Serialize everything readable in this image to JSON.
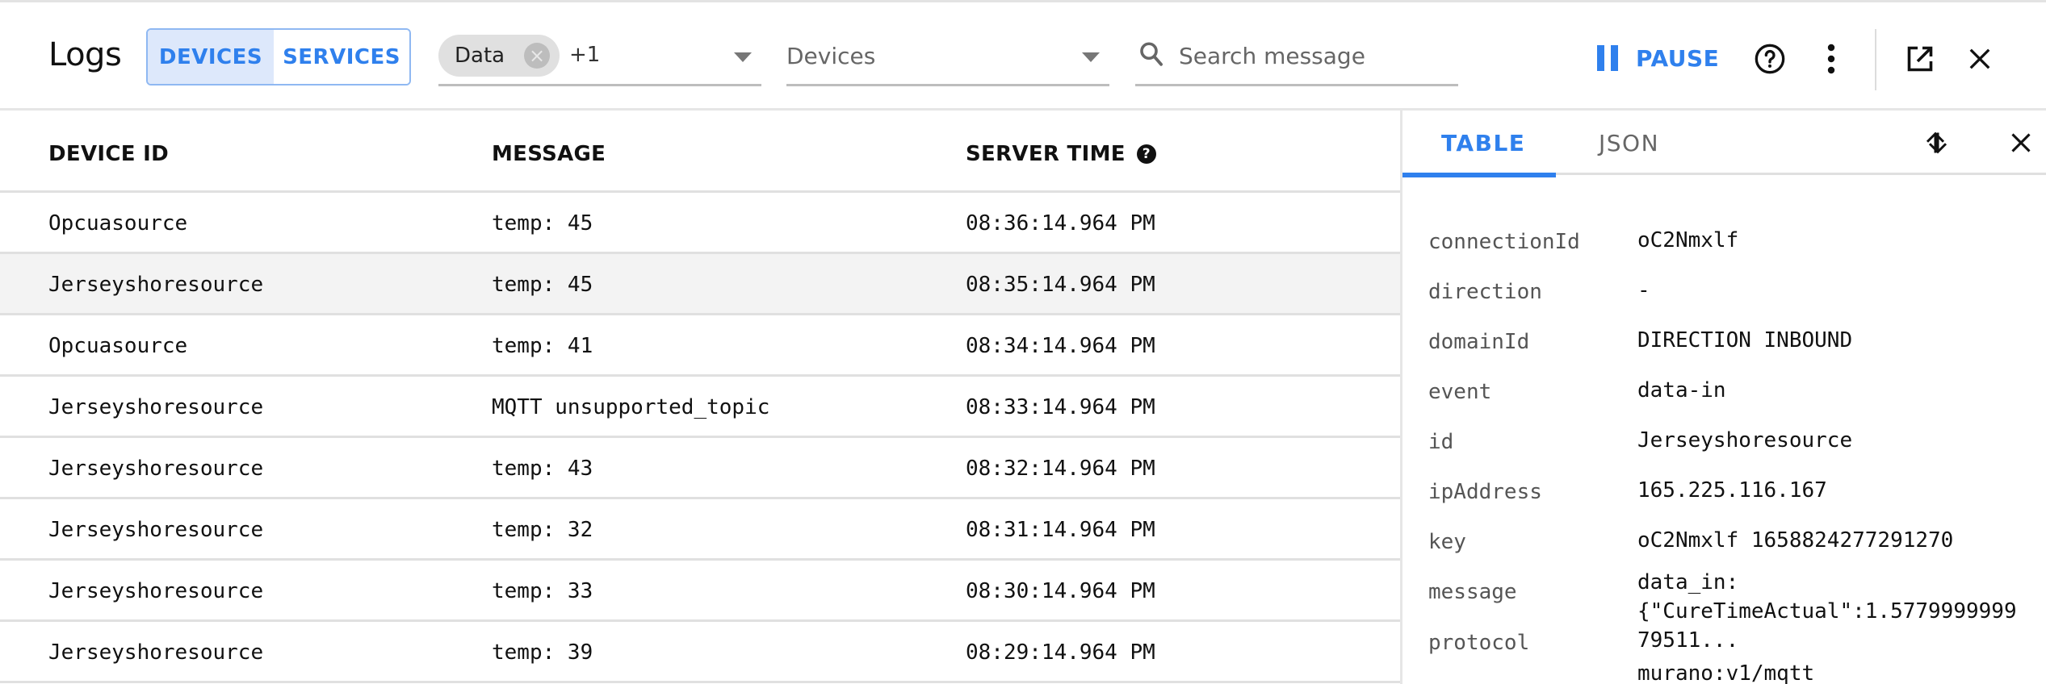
{
  "header": {
    "title": "Logs",
    "toggle": {
      "devices_label": "DEVICES",
      "services_label": "SERVICES",
      "active": "DEVICES"
    },
    "type_filter": {
      "chip_label": "Data",
      "extra_count": "+1"
    },
    "device_filter": {
      "placeholder": "Devices"
    },
    "search": {
      "placeholder": "Search message",
      "value": ""
    },
    "pause_label": "PAUSE",
    "icons": {
      "help": "help-circle-icon",
      "more": "more-vertical-icon",
      "open": "open-in-new-icon",
      "close": "close-icon"
    }
  },
  "colors": {
    "accent": "#2f80ed",
    "toggle_active_bg": "#dde8fb",
    "selected_row_bg": "#f3f3f3"
  },
  "table": {
    "columns": [
      "DEVICE ID",
      "MESSAGE",
      "SERVER TIME"
    ],
    "selected_index": 1,
    "rows": [
      {
        "device_id": "Opcuasource",
        "message": "temp: 45",
        "server_time": "08:36:14.964 PM"
      },
      {
        "device_id": "Jerseyshoresource",
        "message": "temp: 45",
        "server_time": "08:35:14.964 PM"
      },
      {
        "device_id": "Opcuasource",
        "message": "temp: 41",
        "server_time": "08:34:14.964 PM"
      },
      {
        "device_id": "Jerseyshoresource",
        "message": "MQTT unsupported_topic",
        "server_time": "08:33:14.964 PM"
      },
      {
        "device_id": "Jerseyshoresource",
        "message": "temp: 43",
        "server_time": "08:32:14.964 PM"
      },
      {
        "device_id": "Jerseyshoresource",
        "message": "temp: 32",
        "server_time": "08:31:14.964 PM"
      },
      {
        "device_id": "Jerseyshoresource",
        "message": "temp: 33",
        "server_time": "08:30:14.964 PM"
      },
      {
        "device_id": "Jerseyshoresource",
        "message": "temp: 39",
        "server_time": "08:29:14.964 PM"
      }
    ]
  },
  "detail": {
    "tabs": [
      "TABLE",
      "JSON"
    ],
    "active_tab": "TABLE",
    "fields": [
      {
        "key": "connectionId",
        "value": "oC2Nmxlf"
      },
      {
        "key": "direction",
        "value": "-"
      },
      {
        "key": "domainId",
        "value": "DIRECTION INBOUND"
      },
      {
        "key": "event",
        "value": "data-in"
      },
      {
        "key": "id",
        "value": "Jerseyshoresource"
      },
      {
        "key": "ipAddress",
        "value": "165.225.116.167"
      },
      {
        "key": "key",
        "value": "oC2Nmxlf 1658824277291270"
      },
      {
        "key": "message",
        "value": "data_in:\n{\"CureTimeActual\":1.5779999999\n79511..."
      },
      {
        "key": "protocol",
        "value": "murano:v1/mqtt"
      }
    ]
  }
}
